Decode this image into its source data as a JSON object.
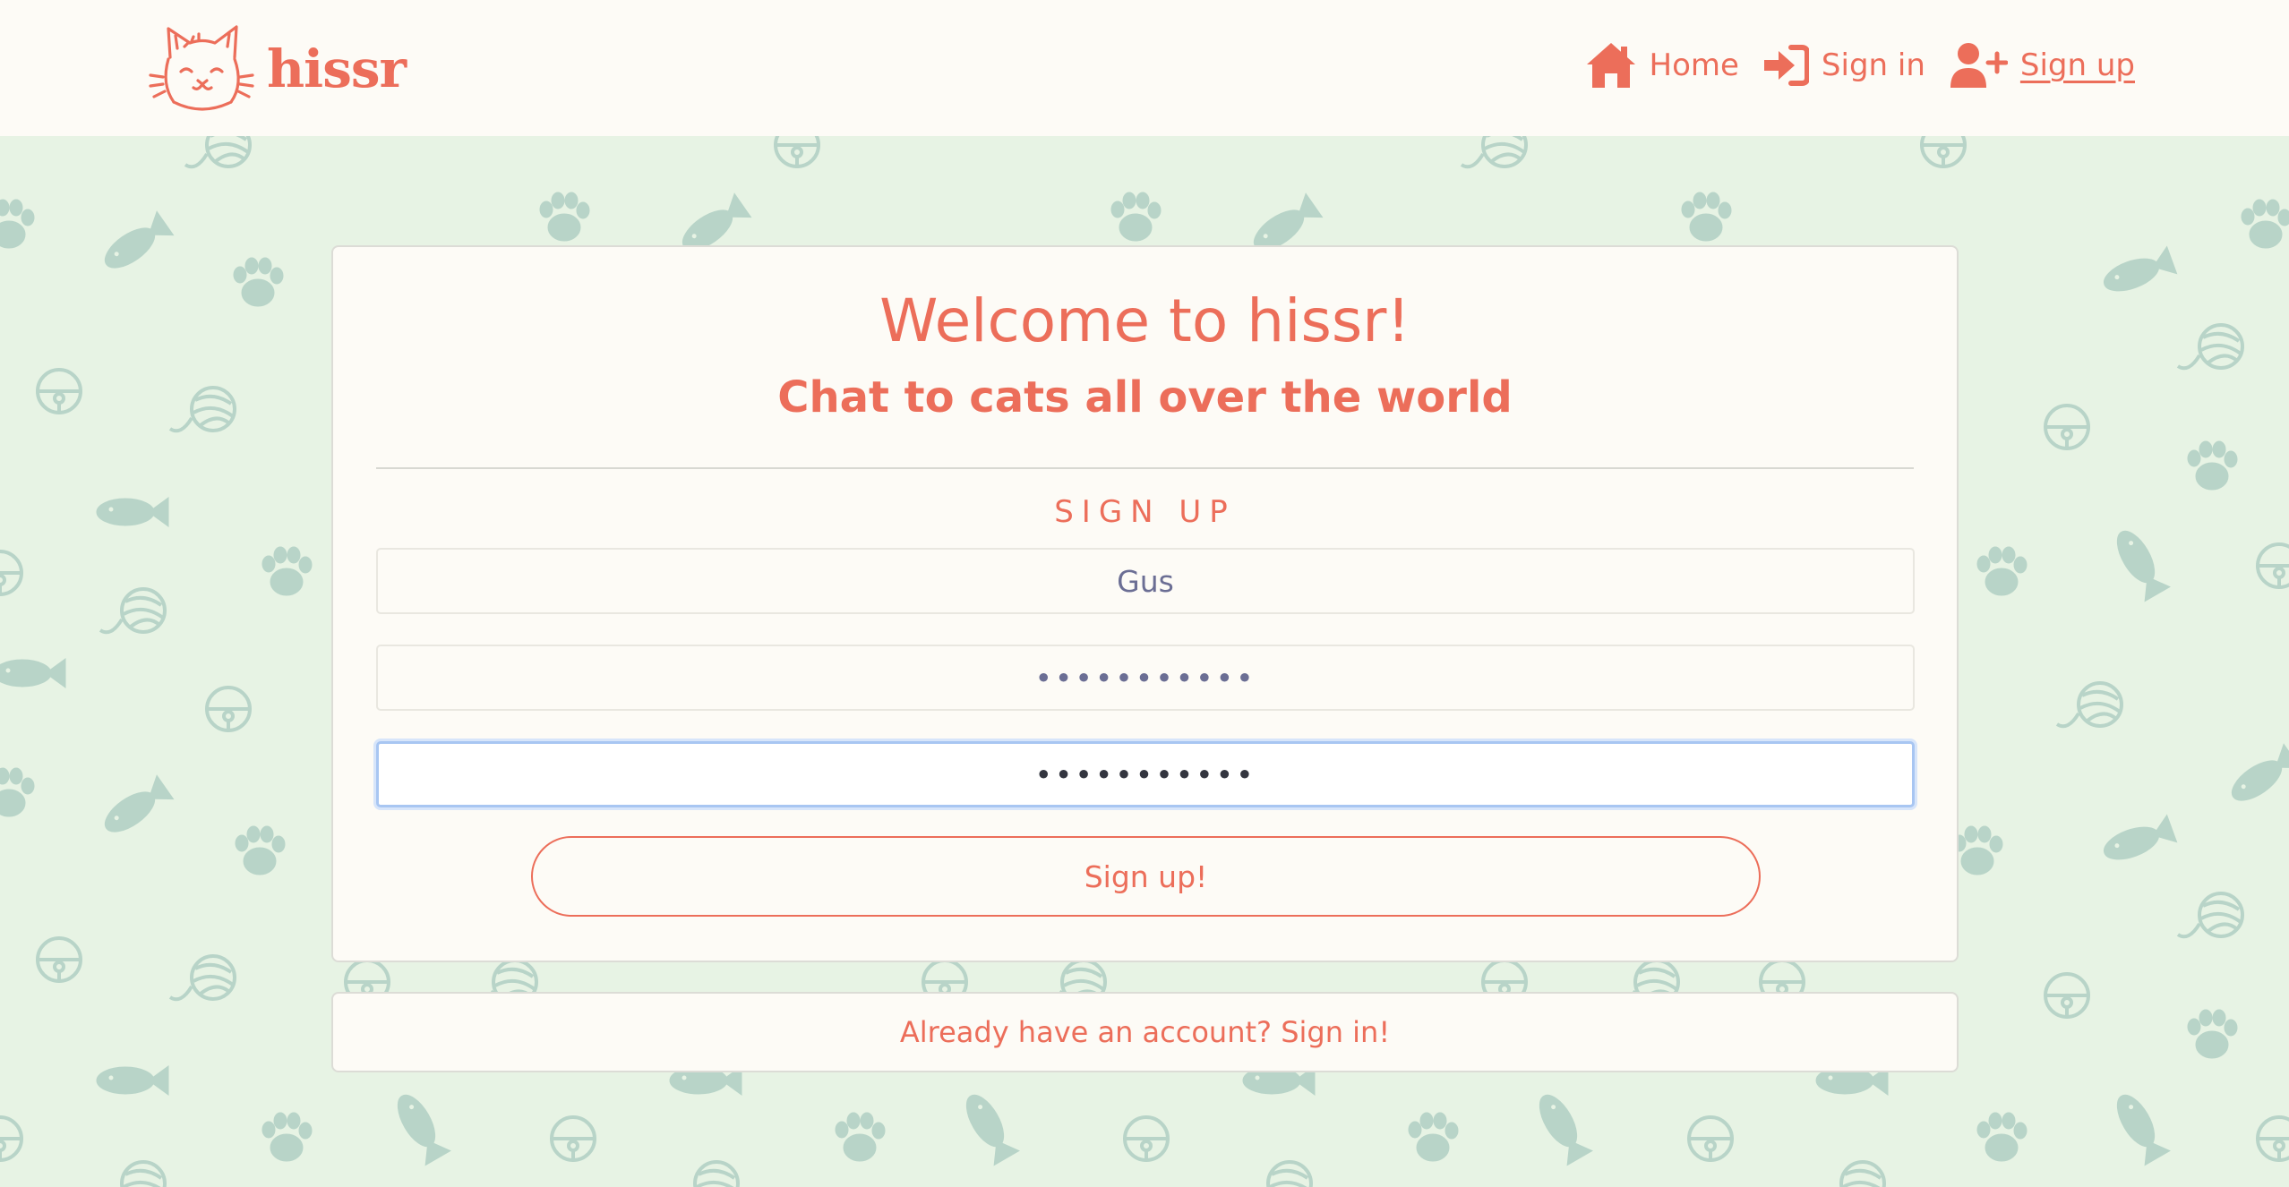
{
  "brand": {
    "name": "hissr",
    "logo_icon": "cat-face-icon"
  },
  "nav": {
    "items": [
      {
        "label": "Home",
        "icon": "home-icon"
      },
      {
        "label": "Sign in",
        "icon": "sign-in-icon"
      },
      {
        "label": "Sign up",
        "icon": "user-plus-icon",
        "active": true
      }
    ]
  },
  "welcome": {
    "title": "Welcome to hissr!",
    "subtitle": "Chat to cats all over the world"
  },
  "form": {
    "heading": "SIGN UP",
    "username_value": "Gus",
    "password_value": "•••••••••••",
    "confirm_password_value": "•••••••••••",
    "submit_label": "Sign up!"
  },
  "footer": {
    "signin_link": "Already have an account? Sign in!"
  },
  "colors": {
    "accent": "#ec6e5a",
    "background": "#e7f3e4",
    "card": "#fdfbf6",
    "pattern": "#b8d4c8",
    "focus_border": "#a8c6f2"
  }
}
